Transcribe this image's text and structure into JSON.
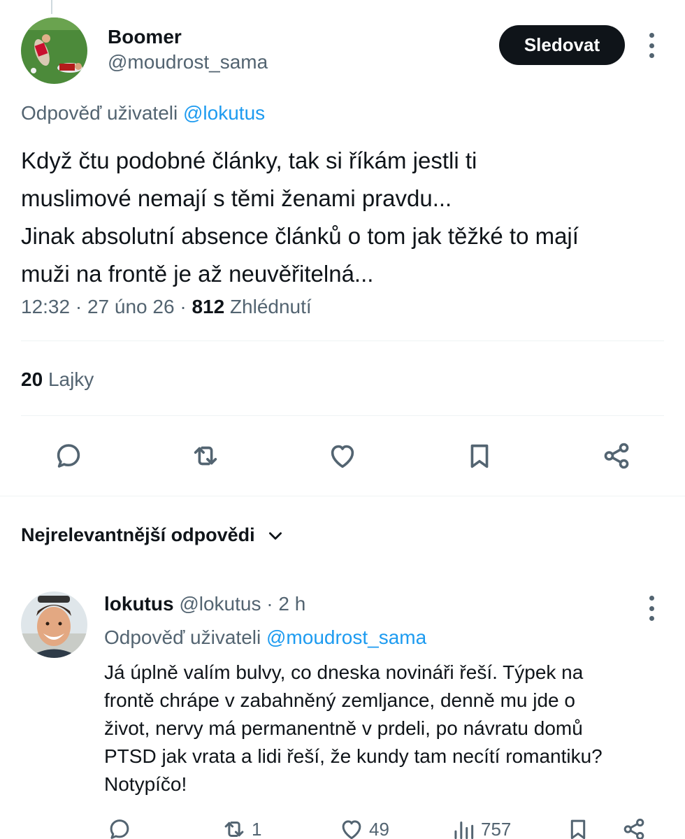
{
  "tweet": {
    "author_name": "Boomer",
    "author_handle": "@moudrost_sama",
    "follow_label": "Sledovat",
    "reply_prefix": "Odpověď uživateli",
    "reply_mention": "@lokutus",
    "text_lines": [
      "Když čtu podobné články,  tak si říkám jestli ti",
      "muslimové nemají s těmi ženami pravdu...",
      "Jinak absolutní absence článků o tom jak těžké to mají",
      "muži na frontě je až neuvěřitelná..."
    ],
    "time": "12:32",
    "sep": "·",
    "date": "27 úno 26",
    "views_count": "812",
    "views_label": "Zhlédnutí",
    "likes_count": "20",
    "likes_label": "Lajky"
  },
  "icons": {
    "reply": "reply-icon",
    "retweet": "retweet-icon",
    "like": "heart-icon",
    "bookmark": "bookmark-icon",
    "share": "share-icon",
    "more": "more-vertical-icon",
    "chevron": "chevron-down-icon",
    "views": "bar-chart-icon"
  },
  "replies_section": {
    "sort_label": "Nejrelevantnější odpovědi"
  },
  "reply": {
    "author_name": "lokutus",
    "author_handle": "@lokutus",
    "sep": "·",
    "time": "2 h",
    "reply_prefix": "Odpověď uživateli",
    "reply_mention": "@moudrost_sama",
    "text_lines": [
      "Já úplně valím bulvy, co dneska novináři řeší. Týpek na",
      "frontě chrápe v zabahněný zemljance, denně mu jde o",
      "život, nervy má permanentně v prdeli, po návratu domů",
      "PTSD jak vrata a lidi řeší, že kundy tam necítí romantiku?",
      "Notypíčo!"
    ],
    "retweets": "1",
    "likes": "49",
    "views": "757"
  },
  "colors": {
    "text": "#0f1419",
    "secondary": "#536471",
    "link": "#1d9bf0",
    "divider": "#eff3f4",
    "button": "#0f1419"
  }
}
